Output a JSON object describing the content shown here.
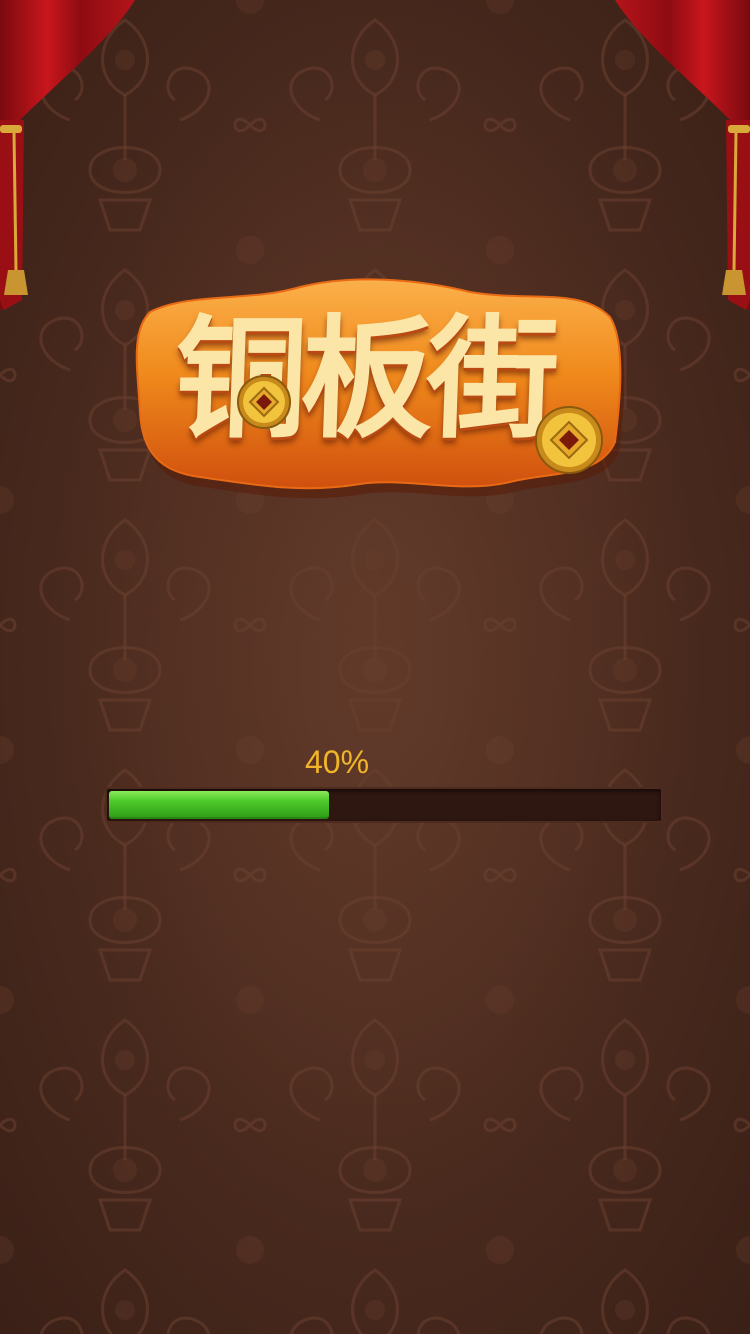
{
  "app": {
    "logo_text": "铜板街",
    "logo_icons": [
      "copper-coin-icon",
      "copper-coin-icon"
    ],
    "decorations": [
      "red-curtain-left",
      "red-curtain-right"
    ]
  },
  "loading": {
    "percent_label": "40%",
    "progress": 0.4
  },
  "colors": {
    "background": "#4a2a1e",
    "logo_orange": "#f08a1c",
    "logo_text": "#fbe6a8",
    "progress_text": "#f2b428",
    "progress_fill": "#4ecb2c",
    "progress_track": "#2e1710",
    "curtain_red": "#b4141a",
    "gold": "#e8b640"
  }
}
